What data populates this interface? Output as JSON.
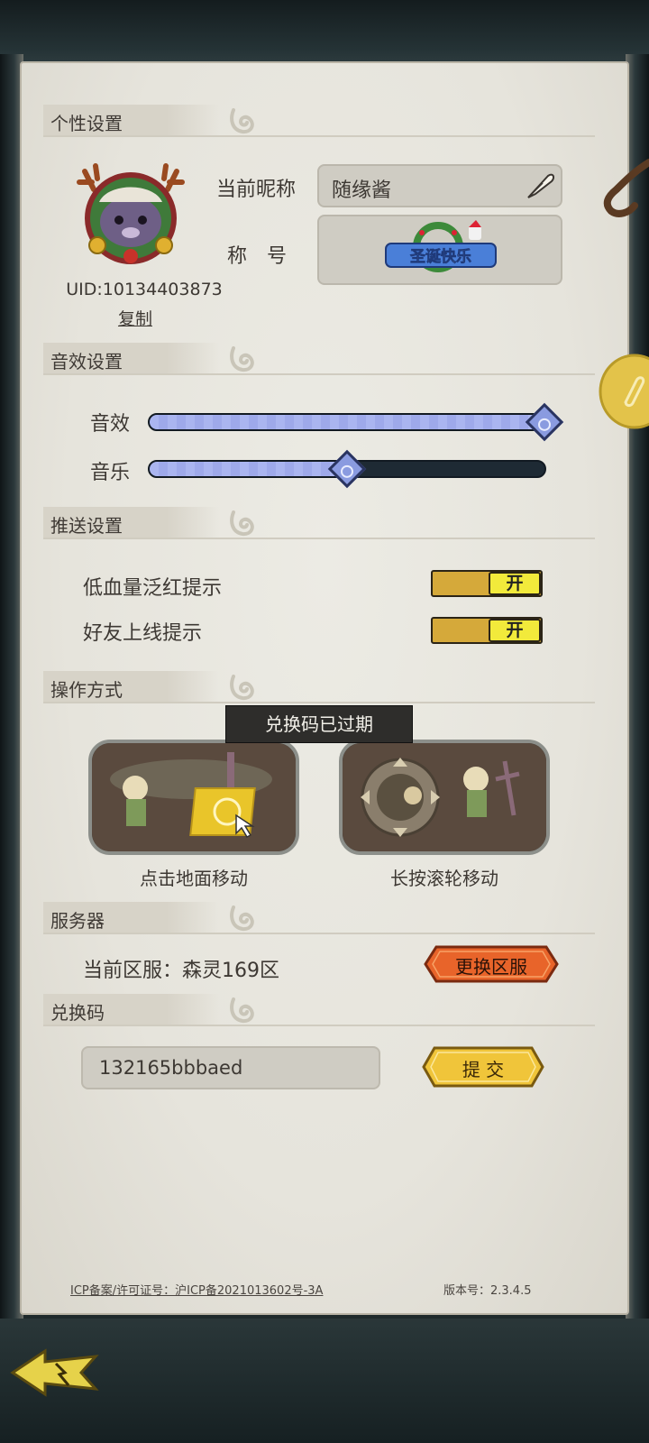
{
  "sections": {
    "personal": "个性设置",
    "sound": "音效设置",
    "push": "推送设置",
    "control": "操作方式",
    "server": "服务器",
    "redeem": "兑换码"
  },
  "profile": {
    "nickname_label": "当前昵称",
    "nickname": "随缘酱",
    "title_label": "称　号",
    "title_badge": "圣诞快乐",
    "uid": "UID:10134403873",
    "copy": "复制"
  },
  "sound": {
    "sfx_label": "音效",
    "sfx_level": 1.0,
    "music_label": "音乐",
    "music_level": 0.5
  },
  "push": {
    "items": [
      {
        "label": "低血量泛红提示",
        "state": "开"
      },
      {
        "label": "好友上线提示",
        "state": "开"
      }
    ]
  },
  "control": {
    "tooltip": "兑换码已过期",
    "mode_tap": "点击地面移动",
    "mode_wheel": "长按滚轮移动"
  },
  "server": {
    "current": "当前区服：森灵169区",
    "change_button": "更换区服"
  },
  "redeem": {
    "code_value": "132165bbbaed",
    "submit_button": "提 交"
  },
  "footer": {
    "icp": "ICP备案/许可证号：沪ICP备2021013602号-3A",
    "version": "版本号：2.3.4.5"
  },
  "colors": {
    "paper": "#e6e4dc",
    "slider_fill": "#aab5f0",
    "toggle_on": "#f2ea3b",
    "toggle_track": "#d5a93a",
    "button_orange": "#e8642a",
    "button_gold": "#f0c53a"
  }
}
